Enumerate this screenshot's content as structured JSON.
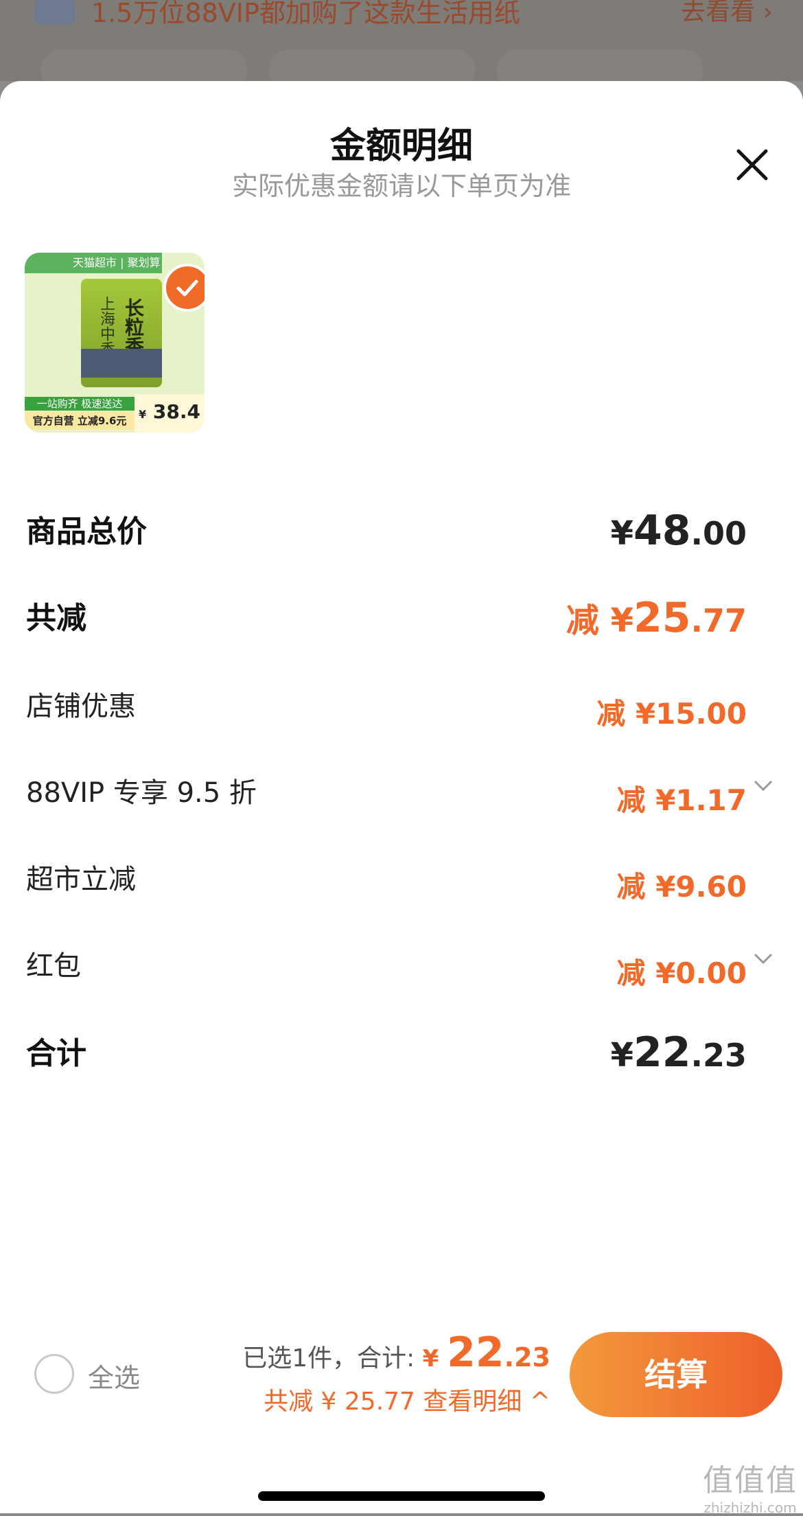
{
  "banner": {
    "text": "1.5万位88VIP都加购了这款生活用纸",
    "link": "去看看 ›"
  },
  "sheet": {
    "title": "金额明细",
    "subtitle": "实际优惠金额请以下单页为准",
    "close_icon": "close-icon"
  },
  "product": {
    "tag": "天猫超市 | 聚划算",
    "bag_line1": "上海中香",
    "bag_line2": "长粒香",
    "strip1": "一站购齐 极速送达",
    "strip2": "官方自营 立减9.6元",
    "price_symbol": "¥",
    "price": "38.4",
    "selected": true
  },
  "rows": [
    {
      "label": "商品总价",
      "prefix": "¥",
      "int": "48",
      "dec": ".00"
    },
    {
      "label": "共减",
      "prefix": "减 ¥",
      "int": "25",
      "dec": ".77"
    },
    {
      "label": "店铺优惠",
      "amount": "减 ¥15.00"
    },
    {
      "label": "88VIP 专享 9.5 折",
      "amount": "减 ¥1.17",
      "expandable": true
    },
    {
      "label": "超市立减",
      "amount": "减 ¥9.60"
    },
    {
      "label": "红包",
      "amount": "减 ¥0.00",
      "expandable": true
    },
    {
      "label": "合计",
      "prefix": "¥",
      "int": "22",
      "dec": ".23"
    }
  ],
  "footer": {
    "select_all": "全选",
    "selected_text": "已选1件，合计: ",
    "total_symbol": "¥ ",
    "total_int": "22",
    "total_dec": ".23",
    "savings_text": "共减 ¥ 25.77  查看明细 ^",
    "checkout": "结算"
  },
  "watermark": {
    "line1": "值值值",
    "line2": "zhizhizhi.com"
  },
  "colors": {
    "accent": "#f26a2a",
    "checkout_start": "#f39a3c",
    "checkout_end": "#ee5f2a"
  }
}
